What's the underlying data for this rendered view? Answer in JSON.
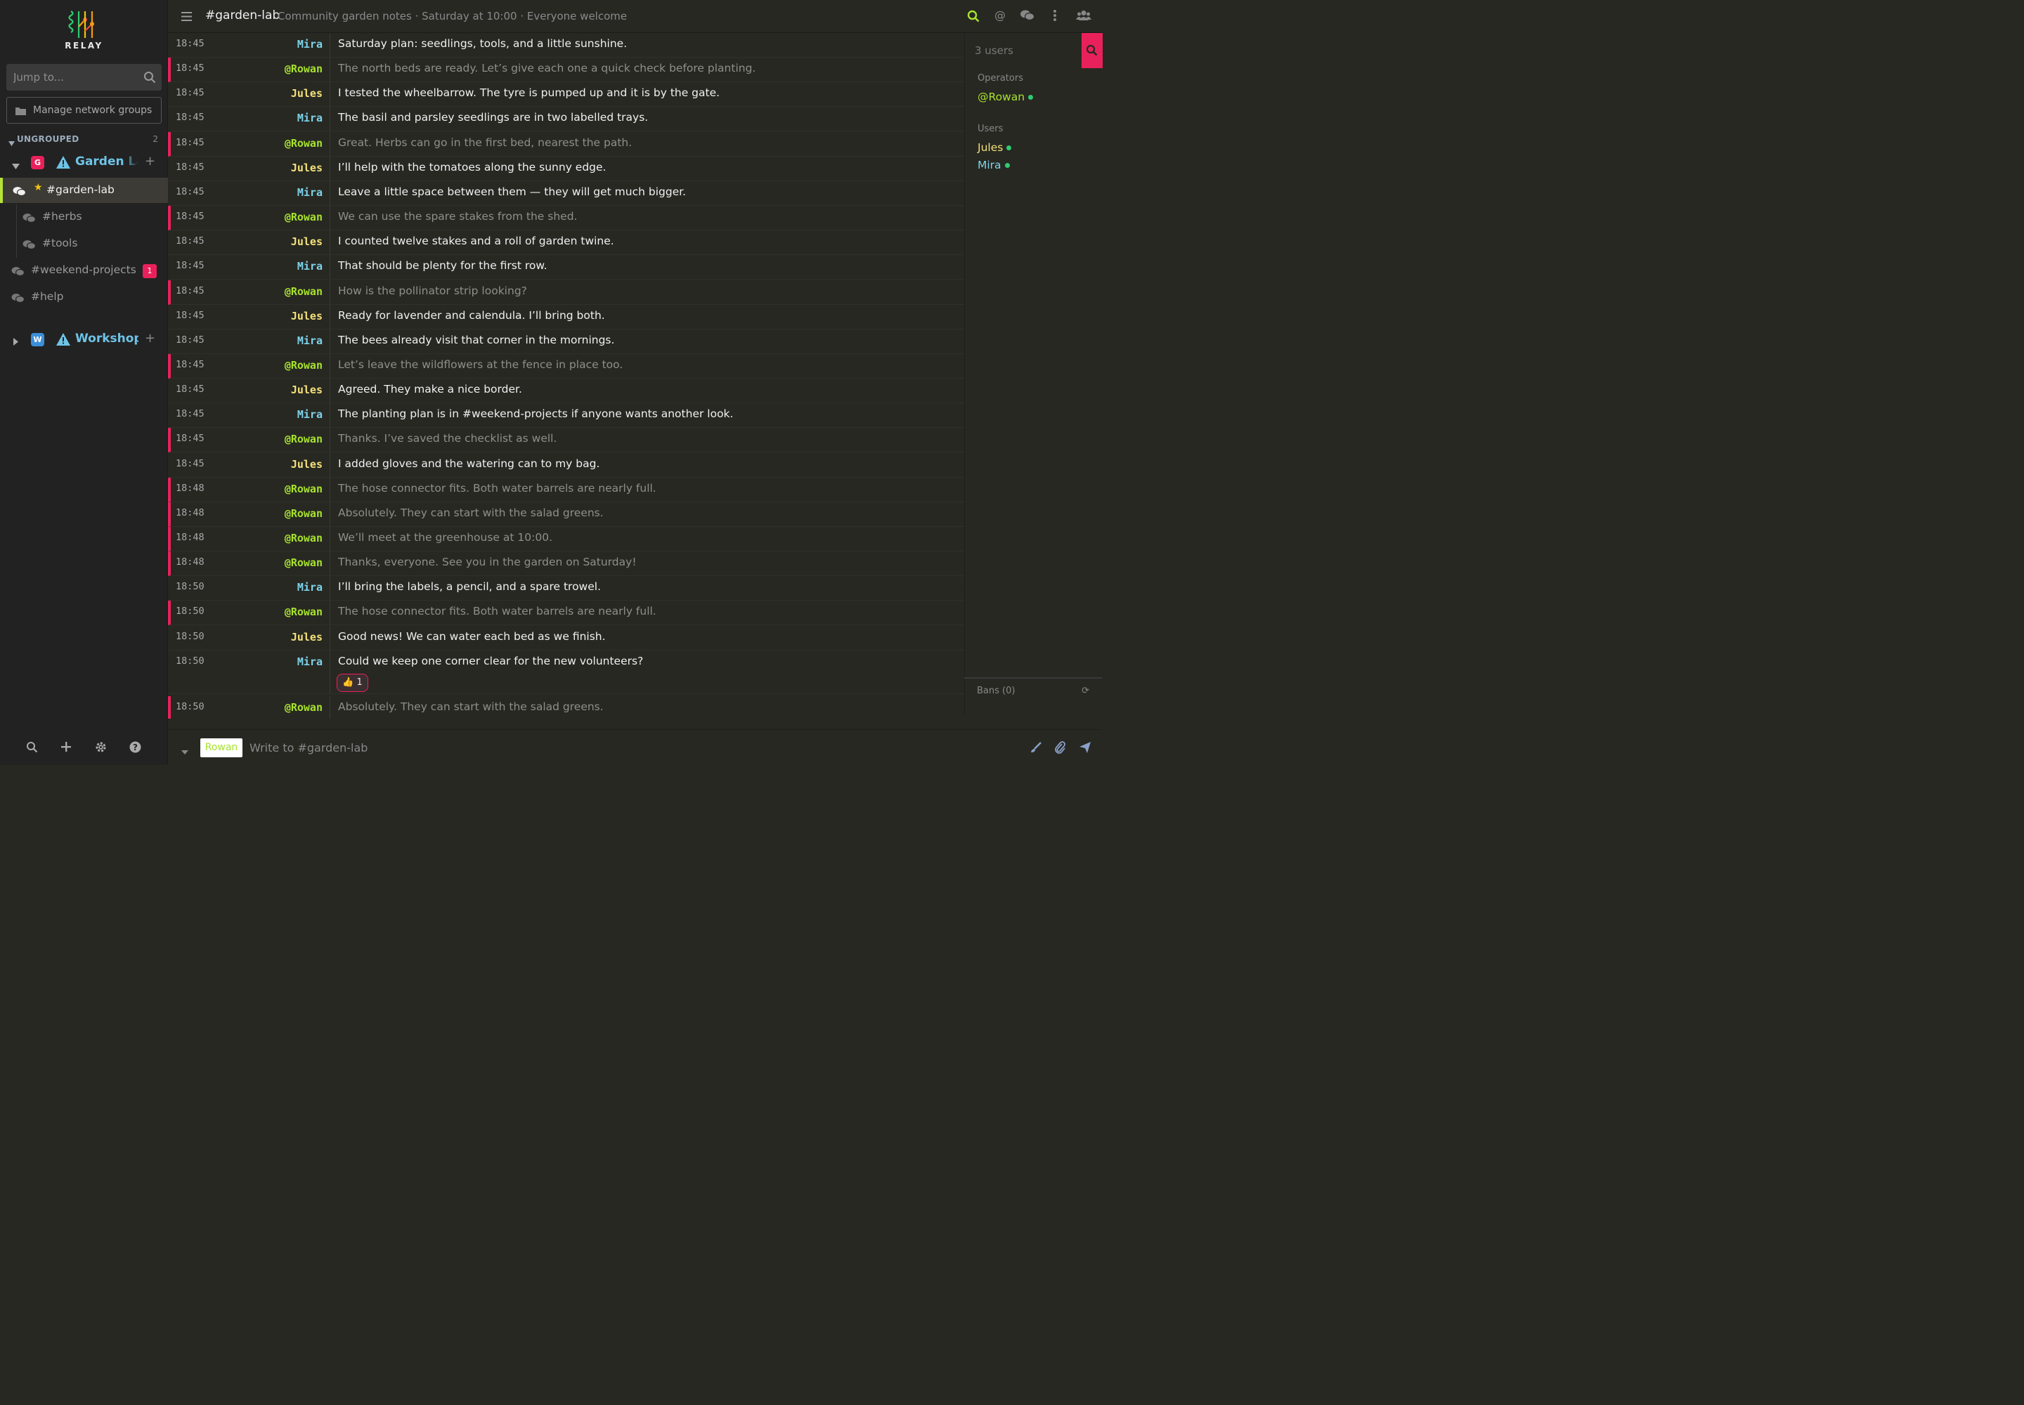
{
  "app": {
    "logo_text": "RELAY"
  },
  "sidebar": {
    "jump_placeholder": "Jump to...",
    "manage_label": "Manage network groups",
    "group_label": "UNGROUPED",
    "group_count": "2",
    "networks": [
      {
        "badge": "G",
        "badge_color": "#e9215b",
        "name": "Garden Lab"
      },
      {
        "badge": "W",
        "badge_color": "#3b8fd9",
        "name": "Workshop"
      }
    ],
    "channels": [
      {
        "name": "#garden-lab"
      },
      {
        "name": "#herbs"
      },
      {
        "name": "#tools"
      },
      {
        "name": "#weekend-projects",
        "unread": "1"
      },
      {
        "name": "#help"
      }
    ]
  },
  "topbar": {
    "title": "#garden-lab",
    "topic": "Community garden notes · Saturday at 10:00 · Everyone welcome"
  },
  "messages": [
    {
      "time": "18:45",
      "from": "Mira",
      "text": "Saturday plan: seedlings, tools, and a little sunshine."
    },
    {
      "time": "18:45",
      "from": "@Rowan",
      "text": "The north beds are ready. Let’s give each one a quick check before planting."
    },
    {
      "time": "18:45",
      "from": "Jules",
      "text": "I tested the wheelbarrow. The tyre is pumped up and it is by the gate."
    },
    {
      "time": "18:45",
      "from": "Mira",
      "text": "The basil and parsley seedlings are in two labelled trays."
    },
    {
      "time": "18:45",
      "from": "@Rowan",
      "text": "Great. Herbs can go in the first bed, nearest the path."
    },
    {
      "time": "18:45",
      "from": "Jules",
      "text": "I’ll help with the tomatoes along the sunny edge."
    },
    {
      "time": "18:45",
      "from": "Mira",
      "text": "Leave a little space between them — they will get much bigger."
    },
    {
      "time": "18:45",
      "from": "@Rowan",
      "text": "We can use the spare stakes from the shed."
    },
    {
      "time": "18:45",
      "from": "Jules",
      "text": "I counted twelve stakes and a roll of garden twine."
    },
    {
      "time": "18:45",
      "from": "Mira",
      "text": "That should be plenty for the first row."
    },
    {
      "time": "18:45",
      "from": "@Rowan",
      "text": "How is the pollinator strip looking?"
    },
    {
      "time": "18:45",
      "from": "Jules",
      "text": "Ready for lavender and calendula. I’ll bring both."
    },
    {
      "time": "18:45",
      "from": "Mira",
      "text": "The bees already visit that corner in the mornings."
    },
    {
      "time": "18:45",
      "from": "@Rowan",
      "text": "Let’s leave the wildflowers at the fence in place too."
    },
    {
      "time": "18:45",
      "from": "Jules",
      "text": "Agreed. They make a nice border."
    },
    {
      "time": "18:45",
      "from": "Mira",
      "text": "The planting plan is in #weekend-projects if anyone wants another look."
    },
    {
      "time": "18:45",
      "from": "@Rowan",
      "text": "Thanks. I’ve saved the checklist as well."
    },
    {
      "time": "18:45",
      "from": "Jules",
      "text": "I added gloves and the watering can to my bag."
    },
    {
      "time": "18:48",
      "from": "@Rowan",
      "text": "The hose connector fits. Both water barrels are nearly full."
    },
    {
      "time": "18:48",
      "from": "@Rowan",
      "text": "Absolutely. They can start with the salad greens."
    },
    {
      "time": "18:48",
      "from": "@Rowan",
      "text": "We’ll meet at the greenhouse at 10:00."
    },
    {
      "time": "18:48",
      "from": "@Rowan",
      "text": "Thanks, everyone. See you in the garden on Saturday!"
    },
    {
      "time": "18:50",
      "from": "Mira",
      "text": "I’ll bring the labels, a pencil, and a spare trowel."
    },
    {
      "time": "18:50",
      "from": "@Rowan",
      "text": "The hose connector fits. Both water barrels are nearly full."
    },
    {
      "time": "18:50",
      "from": "Jules",
      "text": "Good news! We can water each bed as we finish."
    },
    {
      "time": "18:50",
      "from": "Mira",
      "text": "Could we keep one corner clear for the new volunteers?",
      "reaction": "👍 1"
    },
    {
      "time": "18:50",
      "from": "@Rowan",
      "text": "Absolutely. They can start with the salad greens."
    }
  ],
  "userlist": {
    "count": "3 users",
    "operators_label": "Operators",
    "operators": [
      "@Rowan"
    ],
    "users_label": "Users",
    "users": [
      "Jules",
      "Mira"
    ],
    "bans_label": "Bans (0)"
  },
  "input": {
    "nick": "Rowan",
    "placeholder": "Write to #garden-lab"
  },
  "colors": {
    "accent": "#a7e22e",
    "highlight": "#e9215b",
    "nick_mira": "#7dd3ec",
    "nick_jules": "#f3e07a",
    "nick_rowan": "#a7e22e"
  }
}
